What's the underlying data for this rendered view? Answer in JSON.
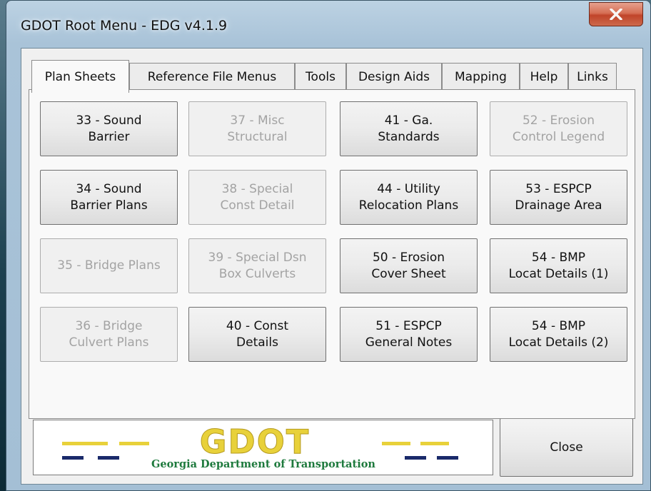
{
  "window": {
    "title": "GDOT Root Menu - EDG v4.1.9",
    "close_glyph": "X"
  },
  "tabs": [
    {
      "label": "Plan Sheets",
      "active": true
    },
    {
      "label": "Reference File Menus",
      "active": false
    },
    {
      "label": "Tools",
      "active": false
    },
    {
      "label": "Design Aids",
      "active": false
    },
    {
      "label": "Mapping",
      "active": false
    },
    {
      "label": "Help",
      "active": false
    },
    {
      "label": "Links",
      "active": false
    }
  ],
  "plan_buttons": [
    {
      "label": "33 - Sound\nBarrier",
      "enabled": true
    },
    {
      "label": "37 - Misc\nStructural",
      "enabled": false
    },
    {
      "label": "41 - Ga.\nStandards",
      "enabled": true
    },
    {
      "label": "52 - Erosion\nControl Legend",
      "enabled": false
    },
    {
      "label": "34 - Sound\nBarrier Plans",
      "enabled": true
    },
    {
      "label": "38 - Special\nConst Detail",
      "enabled": false
    },
    {
      "label": "44 - Utility\nRelocation Plans",
      "enabled": true
    },
    {
      "label": "53 - ESPCP\nDrainage Area",
      "enabled": true
    },
    {
      "label": "35 - Bridge Plans",
      "enabled": false
    },
    {
      "label": "39 - Special Dsn\nBox Culverts",
      "enabled": false
    },
    {
      "label": "50 - Erosion\nCover Sheet",
      "enabled": true
    },
    {
      "label": "54 - BMP\nLocat Details (1)",
      "enabled": true
    },
    {
      "label": "36 - Bridge\nCulvert Plans",
      "enabled": false
    },
    {
      "label": "40 - Const\nDetails",
      "enabled": true
    },
    {
      "label": "51 - ESPCP\nGeneral Notes",
      "enabled": true
    },
    {
      "label": "54 - BMP\nLocat Details (2)",
      "enabled": true
    }
  ],
  "scrollbar": {
    "left_arrow_icon": "left-arrow-icon",
    "right_arrow_icon": "right-arrow-icon"
  },
  "logo": {
    "wordmark": "GDOT",
    "caption": "Georgia Department of Transportation",
    "colors": {
      "gold": "#e8d13a",
      "green": "#1e7a3d",
      "navy": "#1a2a6a"
    }
  },
  "close_button": {
    "label": "Close"
  }
}
